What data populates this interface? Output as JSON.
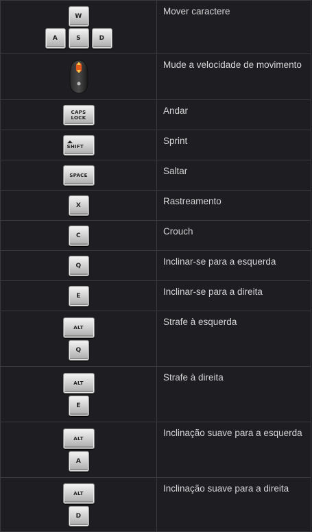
{
  "rows": [
    {
      "keys": [
        "W",
        "A",
        "S",
        "D"
      ],
      "label": "Mover caractere"
    },
    {
      "keys": [
        "mouse-scroll"
      ],
      "label": "Mude a velocidade de movimento"
    },
    {
      "keys": [
        "CAPS",
        "LOCK"
      ],
      "label": "Andar"
    },
    {
      "keys": [
        "SHIFT"
      ],
      "label": "Sprint"
    },
    {
      "keys": [
        "SPACE"
      ],
      "label": "Saltar"
    },
    {
      "keys": [
        "X"
      ],
      "label": "Rastreamento"
    },
    {
      "keys": [
        "C"
      ],
      "label": "Crouch"
    },
    {
      "keys": [
        "Q"
      ],
      "label": "Inclinar-se para a esquerda"
    },
    {
      "keys": [
        "E"
      ],
      "label": "Inclinar-se para a direita"
    },
    {
      "keys": [
        "ALT",
        "Q"
      ],
      "label": "Strafe à esquerda"
    },
    {
      "keys": [
        "ALT",
        "E"
      ],
      "label": "Strafe à direita"
    },
    {
      "keys": [
        "ALT",
        "A"
      ],
      "label": "Inclinação suave para a esquerda"
    },
    {
      "keys": [
        "ALT",
        "D"
      ],
      "label": "Inclinação suave para a direita"
    }
  ],
  "colors": {
    "background": "#1e1e22",
    "border": "#3a3a3e",
    "text": "#d6d6d6",
    "mouse_accent": "#e05a1a"
  },
  "icons": {
    "mouse": "mouse-scroll-icon"
  }
}
